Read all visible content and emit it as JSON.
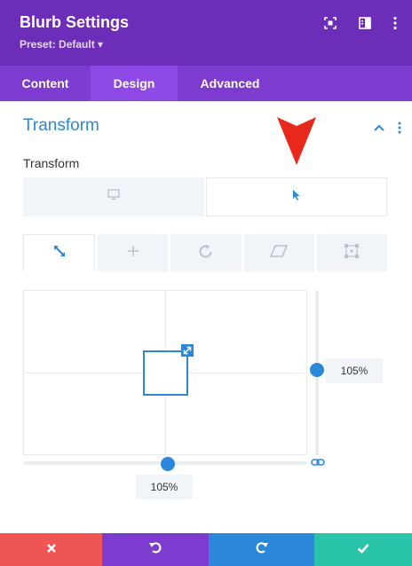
{
  "header": {
    "title": "Blurb Settings",
    "preset": "Preset: Default ▾"
  },
  "tabs": [
    {
      "label": "Content",
      "active": false
    },
    {
      "label": "Design",
      "active": true
    },
    {
      "label": "Advanced",
      "active": false
    }
  ],
  "section": {
    "title": "Transform",
    "field_label": "Transform"
  },
  "sliders": {
    "vertical_value": "105%",
    "horizontal_value": "105%"
  },
  "colors": {
    "header": "#6c2eb9",
    "tabs": "#7d3bcf",
    "accent": "#2b87da",
    "cancel": "#ef5555",
    "undo": "#7e3bd0",
    "redo": "#2b87da",
    "save": "#29c4a9",
    "annotation": "#e8281a"
  }
}
